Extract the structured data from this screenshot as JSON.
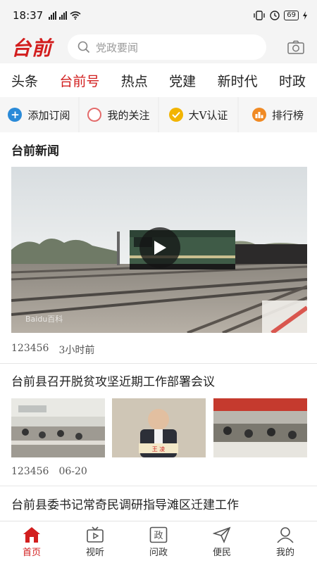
{
  "status_bar": {
    "time": "18:37",
    "battery": "69"
  },
  "header": {
    "logo": "台前",
    "search_placeholder": "党政要闻"
  },
  "tabs": [
    {
      "label": "头条",
      "active": false
    },
    {
      "label": "台前号",
      "active": true
    },
    {
      "label": "热点",
      "active": false
    },
    {
      "label": "党建",
      "active": false
    },
    {
      "label": "新时代",
      "active": false
    },
    {
      "label": "时政",
      "active": false
    }
  ],
  "quick_actions": [
    {
      "label": "添加订阅",
      "icon": "plus-circle-icon",
      "color": "#2a8ad8"
    },
    {
      "label": "我的关注",
      "icon": "circle-outline-icon",
      "color": "#e36b6b"
    },
    {
      "label": "大V认证",
      "icon": "check-circle-icon",
      "color": "#f2b400"
    },
    {
      "label": "排行榜",
      "icon": "ranking-icon",
      "color": "#f08a24"
    }
  ],
  "feed": {
    "section_title": "台前新闻",
    "video_item": {
      "watermark": "Baidu百科",
      "views": "123456",
      "time": "3小时前"
    },
    "article_1": {
      "title": "台前县召开脱贫攻坚近期工作部署会议",
      "views": "123456",
      "time": "06-20"
    },
    "article_2": {
      "title": "台前县委书记常奇民调研指导滩区迁建工作"
    }
  },
  "bottom_nav": [
    {
      "label": "首页",
      "icon": "home-icon",
      "active": true
    },
    {
      "label": "视听",
      "icon": "tv-play-icon",
      "active": false
    },
    {
      "label": "问政",
      "icon": "zheng-icon",
      "active": false
    },
    {
      "label": "便民",
      "icon": "send-icon",
      "active": false
    },
    {
      "label": "我的",
      "icon": "user-icon",
      "active": false
    }
  ],
  "colors": {
    "accent": "#d21e1e"
  }
}
